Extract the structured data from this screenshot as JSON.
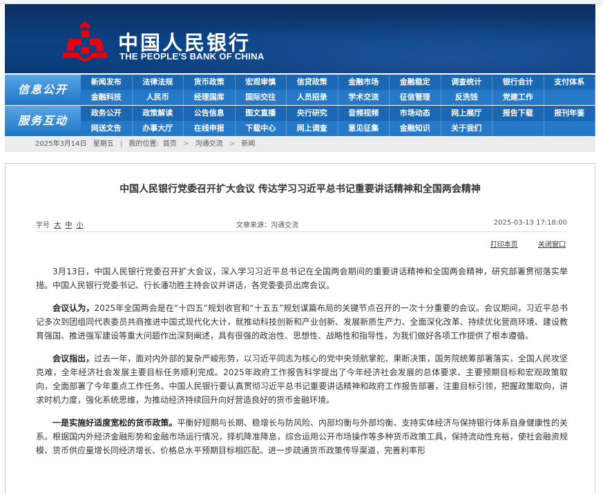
{
  "header": {
    "logo_cn": "中国人民银行",
    "logo_en": "THE PEOPLE'S BANK OF CHINA",
    "brand_color": "#0a4283",
    "logo_color": "#e60012"
  },
  "nav": {
    "row1": {
      "label": "信息公开",
      "items": [
        "新闻发布",
        "法律法规",
        "货币政策",
        "宏观审慎",
        "信贷政策",
        "金融市场",
        "金融稳定",
        "调查统计",
        "银行会计",
        "支付体系",
        "金融科技",
        "人民币",
        "经理国库",
        "国际交往",
        "人员招录",
        "学术交流",
        "征信管理",
        "反洗钱",
        "党建工作",
        ""
      ]
    },
    "row2": {
      "label": "服务互动",
      "items": [
        "政务公开",
        "政策解读",
        "公告信息",
        "图文直播",
        "央行研究",
        "音频视频",
        "市场动态",
        "网上展厅",
        "报告下载",
        "报刊年鉴",
        "网送文告",
        "办事大厅",
        "在线申报",
        "下载中心",
        "网上调查",
        "意见征集",
        "金融知识",
        "关于我们",
        "",
        ""
      ]
    }
  },
  "breadcrumb": {
    "date": "2025年3月14日",
    "weekday": "星期五",
    "location_label": "我的位置:",
    "home": "首页",
    "level1": "沟通交流",
    "level2": "新闻",
    "separator": ">"
  },
  "article": {
    "title": "中国人民银行党委召开扩大会议  传达学习习近平总书记重要讲话精神和全国两会精神",
    "font_size_label": "字号",
    "font_large": "大",
    "font_medium": "中",
    "font_small": "小",
    "source": "文章来源：沟通交流",
    "datetime": "2025-03-13  17:18:00",
    "print_label": "打印本页",
    "close_label": "关闭窗口",
    "paragraphs": [
      {
        "lead": "",
        "text": "3月13日，中国人民银行党委召开扩大会议，深入学习习近平总书记在全国两会期间的重要讲话精神和全国两会精神，研究部署贯彻落实举措。中国人民银行党委书记、行长潘功胜主持会议并讲话，各党委委员出席会议。"
      },
      {
        "lead": "会议认为，",
        "text": "2025年全国两会是在“十四五”规划收官和“十五五”规划谋篇布局的关键节点召开的一次十分重要的会议。会议期间，习近平总书记多次到团组同代表委员共商推进中国式现代化大计，就推动科技创新和产业创新、发展新质生产力、全面深化改革、持续优化营商环境、建设教育强国、推进强军建设等重大问题作出深刻阐述，具有很强的政治性、思想性、战略性和指导性，为我们做好各项工作提供了根本遵循。"
      },
      {
        "lead": "会议指出，",
        "text": "过去一年，面对内外部的复杂严峻形势，以习近平同志为核心的党中央领航掌舵、果断决策，国务院统筹部署落实，全国人民攻坚克难，全年经济社会发展主要目标任务顺利完成。2025年政府工作报告科学提出了今年经济社会发展的总体要求、主要预期目标和宏观政策取向，全面部署了今年重点工作任务。中国人民银行要认真贯彻习近平总书记重要讲话精神和政府工作报告部署，注重目标引领，把握政策取向，讲求时机力度，强化系统思维，为推动经济持续回升向好营造良好的货币金融环境。"
      },
      {
        "lead": "一是实施好适度宽松的货币政策。",
        "text": "平衡好短期与长期、稳增长与防风险、内部均衡与外部均衡、支持实体经济与保持银行体系自身健康性的关系。根据国内外经济金融形势和金融市场运行情况，择机降准降息，综合运用公开市场操作等多种货币政策工具，保持流动性充裕，使社会融资规模、货币供应量增长同经济增长、价格总水平预期目标相匹配。进一步疏通货币政策传导渠道，完善利率形"
      }
    ]
  }
}
